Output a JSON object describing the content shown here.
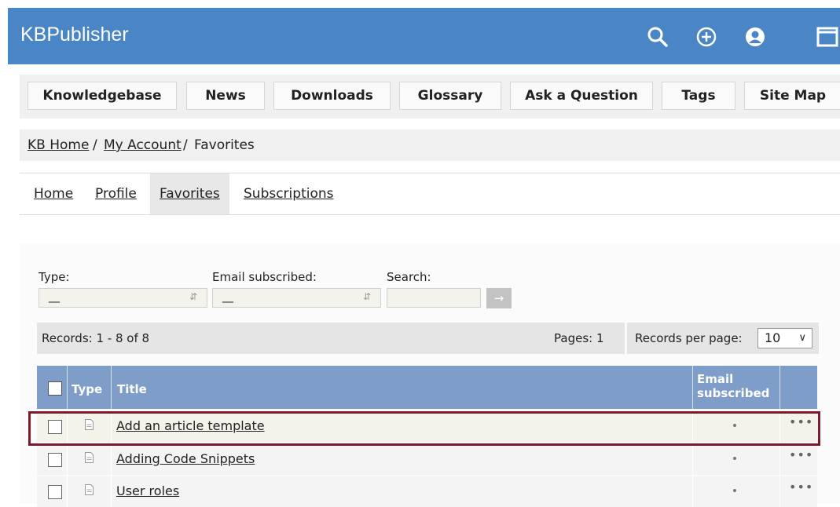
{
  "app": {
    "brand": "KBPublisher"
  },
  "header_icons": [
    "search-icon",
    "plus-circle-icon",
    "user-circle-icon",
    "window-icon"
  ],
  "nav": {
    "items": [
      {
        "label": "Knowledgebase"
      },
      {
        "label": "News"
      },
      {
        "label": "Downloads"
      },
      {
        "label": "Glossary"
      },
      {
        "label": "Ask a Question"
      },
      {
        "label": "Tags"
      },
      {
        "label": "Site Map"
      }
    ]
  },
  "breadcrumb": {
    "home": "KB Home",
    "sep": "/",
    "account": "My Account",
    "current": "Favorites"
  },
  "tabs": {
    "items": [
      {
        "label": "Home"
      },
      {
        "label": "Profile"
      },
      {
        "label": "Favorites"
      },
      {
        "label": "Subscriptions"
      }
    ],
    "active": "Favorites"
  },
  "filters": {
    "type_label": "Type:",
    "type_value": "__",
    "email_label": "Email subscribed:",
    "email_value": "__",
    "search_label": "Search:",
    "search_value": "",
    "go_label": "→"
  },
  "records": {
    "summary": "Records: 1 - 8 of 8",
    "pages": "Pages: 1",
    "per_page_label": "Records per page:",
    "per_page_value": "10"
  },
  "table": {
    "columns": {
      "type": "Type",
      "title": "Title",
      "email_line1": "Email",
      "email_line2": "subscribed"
    },
    "rows": [
      {
        "title": "Add an article template",
        "email": "•",
        "more": "•••",
        "highlighted": true
      },
      {
        "title": "Adding Code Snippets",
        "email": "•",
        "more": "•••",
        "highlighted": false
      },
      {
        "title": "User roles",
        "email": "•",
        "more": "•••",
        "highlighted": false
      }
    ]
  },
  "colors": {
    "header_bg": "#4a86c5",
    "table_header_bg": "#7e9dc8",
    "highlight_border": "#7b1b2c"
  }
}
